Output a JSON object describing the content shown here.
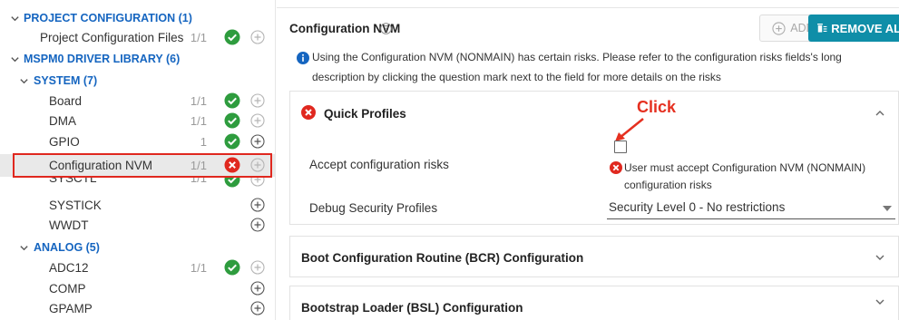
{
  "sidebar": {
    "project_configuration": {
      "label": "PROJECT CONFIGURATION (1)"
    },
    "project_configuration_files": {
      "label": "Project Configuration Files",
      "count": "1/1"
    },
    "driver_library": {
      "label": "MSPM0 DRIVER LIBRARY (6)"
    },
    "system": {
      "label": "SYSTEM (7)"
    },
    "system_items": [
      {
        "label": "Board",
        "count": "1/1",
        "status": "ok"
      },
      {
        "label": "DMA",
        "count": "1/1",
        "status": "ok"
      },
      {
        "label": "GPIO",
        "count": "1",
        "status": "ok"
      },
      {
        "label": "Configuration NVM",
        "count": "1/1",
        "status": "error"
      },
      {
        "label": "SYSCTL",
        "count": "1/1",
        "status": "ok"
      },
      {
        "label": "SYSTICK",
        "count": "",
        "status": "none"
      },
      {
        "label": "WWDT",
        "count": "",
        "status": "none"
      }
    ],
    "analog": {
      "label": "ANALOG (5)"
    },
    "analog_items": [
      {
        "label": "ADC12",
        "count": "1/1",
        "status": "ok"
      },
      {
        "label": "COMP",
        "count": "",
        "status": "none"
      },
      {
        "label": "GPAMP",
        "count": "",
        "status": "none"
      }
    ]
  },
  "main": {
    "title": "Configuration NVM",
    "add_label": "ADD",
    "remove_label": "REMOVE ALL",
    "info_text": "Using the Configuration NVM (NONMAIN) has certain risks. Please refer to the configuration risks fields's long description by clicking the question mark next to the field for more details on the risks",
    "quick_profiles": {
      "title": "Quick Profiles",
      "annotation": "Click",
      "accept_label": "Accept configuration risks",
      "accept_error": "User must accept Configuration NVM (NONMAIN) configuration risks",
      "debug_label": "Debug Security Profiles",
      "debug_value": "Security Level 0 - No restrictions"
    },
    "bcr_title": "Boot Configuration Routine (BCR) Configuration",
    "bsl_title": "Bootstrap Loader (BSL) Configuration"
  },
  "colors": {
    "accent": "#1565c0",
    "ok": "#2e9c3e",
    "error": "#e0281f",
    "remove_button": "#0f8ea8",
    "annotation": "#e53020"
  },
  "icons": [
    "chevron-down-icon",
    "check-circle-icon",
    "error-circle-icon",
    "plus-circle-icon",
    "help-icon",
    "info-icon",
    "trash-icon",
    "chevron-up-icon"
  ]
}
